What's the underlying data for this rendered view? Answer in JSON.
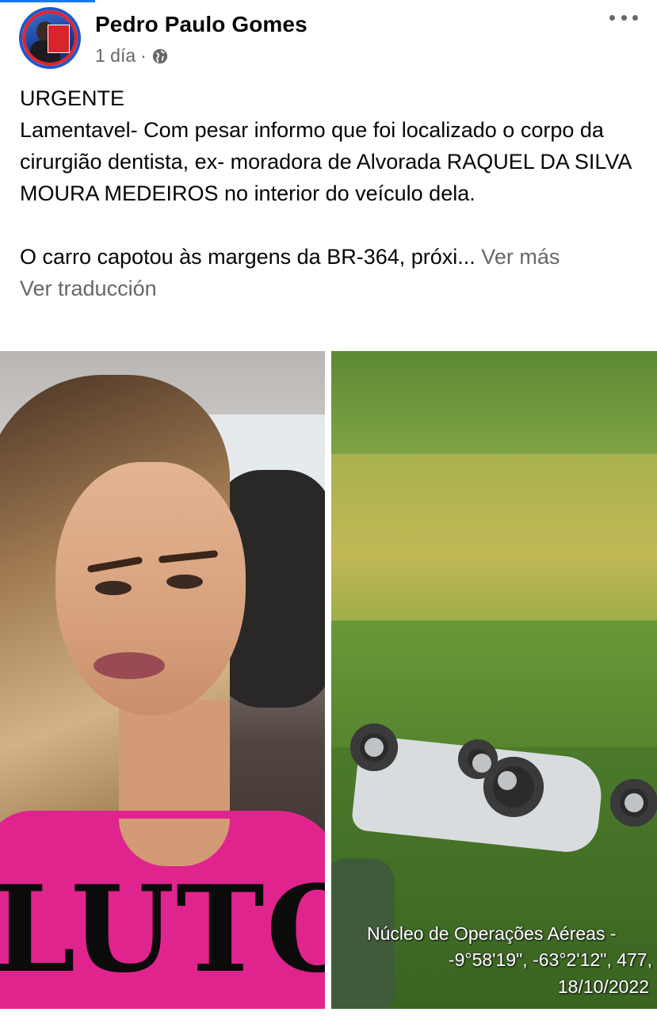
{
  "post": {
    "author": "Pedro Paulo Gomes",
    "timestamp": "1 día",
    "separator": "·",
    "audience_icon": "globe-icon",
    "more_icon": "more-horizontal-icon",
    "text": {
      "line_urgent": "URGENTE",
      "paragraph_1": "Lamentavel- Com pesar informo que foi localizado o corpo da cirurgião dentista, ex- moradora de Alvorada RAQUEL DA SILVA MOURA MEDEIROS no interior do veículo dela.",
      "paragraph_2": "O carro capotou às margens da BR-364, próxi...",
      "see_more": "Ver más",
      "translate": "Ver traducción"
    },
    "photos": {
      "left_overlay_text": "LUTO",
      "right_watermark": {
        "line1": "Núcleo de Operações Aéreas -",
        "line2": "-9°58'19\", -63°2'12\", 477,",
        "line3": "18/10/2022"
      }
    }
  },
  "colors": {
    "accent": "#1877f2",
    "text_primary": "#050505",
    "text_secondary": "#65676b",
    "shirt_pink": "#e0248d"
  }
}
